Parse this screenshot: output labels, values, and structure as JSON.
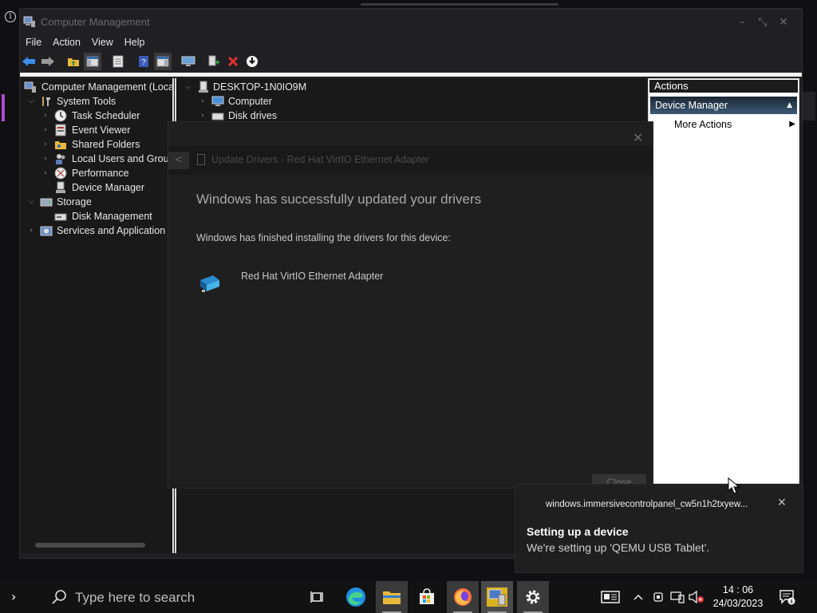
{
  "window": {
    "title": "Computer Management",
    "menu": [
      "File",
      "Action",
      "View",
      "Help"
    ]
  },
  "tree": {
    "root": "Computer Management (Local",
    "items": [
      {
        "label": "System Tools",
        "icon": "tools-icon"
      },
      {
        "label": "Task Scheduler",
        "icon": "clock-icon"
      },
      {
        "label": "Event Viewer",
        "icon": "event-viewer-icon"
      },
      {
        "label": "Shared Folders",
        "icon": "shared-folder-icon"
      },
      {
        "label": "Local Users and Grou",
        "icon": "users-icon"
      },
      {
        "label": "Performance",
        "icon": "performance-icon"
      },
      {
        "label": "Device Manager",
        "icon": "device-manager-icon"
      },
      {
        "label": "Storage",
        "icon": "storage-icon"
      },
      {
        "label": "Disk Management",
        "icon": "disk-icon"
      },
      {
        "label": "Services and Application",
        "icon": "services-icon"
      }
    ]
  },
  "devices": {
    "root": "DESKTOP-1N0IO9M",
    "items": [
      "Computer",
      "Disk drives"
    ]
  },
  "actions": {
    "header": "Actions",
    "section": "Device Manager",
    "more": "More Actions"
  },
  "dialog": {
    "nav_title": "Update Drivers - Red Hat VirtIO Ethernet Adapter",
    "heading": "Windows has successfully updated your drivers",
    "text": "Windows has finished installing the drivers for this device:",
    "device_name": "Red Hat VirtIO Ethernet Adapter",
    "close_label": "Close"
  },
  "toast": {
    "app": "windows.immersivecontrolpanel_cw5n1h2txyew...",
    "title": "Setting up a device",
    "body": "We're setting up 'QEMU USB Tablet'."
  },
  "taskbar": {
    "search_placeholder": "Type here to search",
    "time": "14 : 06",
    "date": "24/03/2023",
    "notification_count": "4"
  },
  "colors": {
    "accent_blue": "#3c5a76",
    "folder_yellow": "#e8b83a",
    "close_red": "#e03030"
  }
}
